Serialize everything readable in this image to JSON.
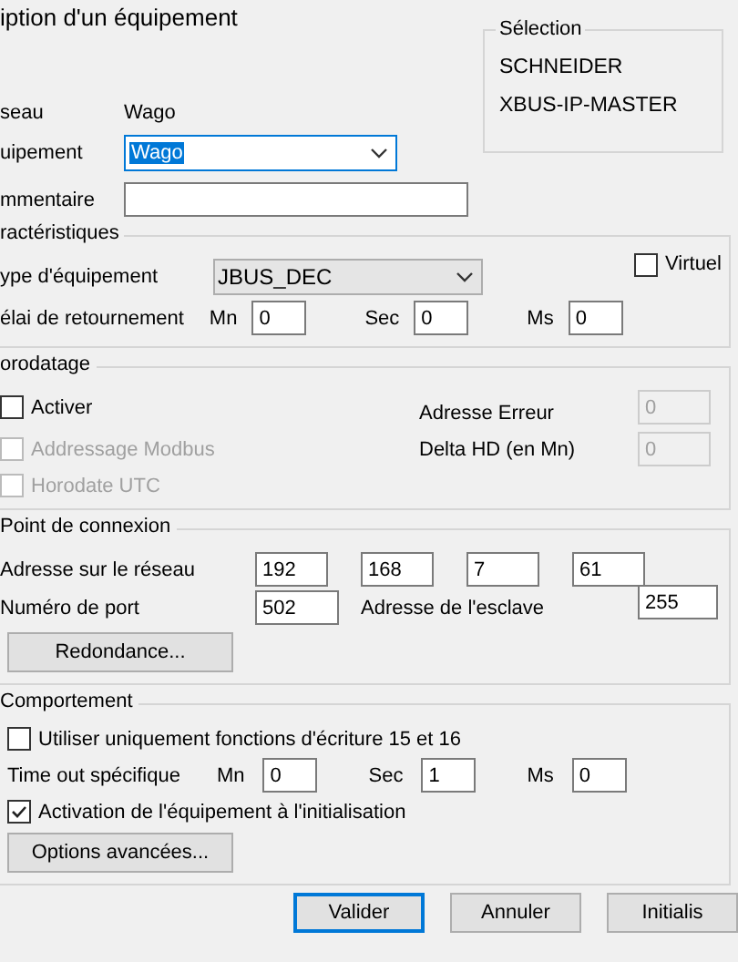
{
  "window": {
    "title": "iption d'un équipement"
  },
  "selection": {
    "title": "Sélection",
    "items": [
      "SCHNEIDER",
      "XBUS-IP-MASTER"
    ]
  },
  "identity": {
    "network_label": "seau",
    "network_value": "Wago",
    "equipment_label": "uipement",
    "equipment_value": "Wago",
    "equipment_text_selected": true,
    "comment_label": "mmentaire"
  },
  "characteristics": {
    "title": "ractéristiques",
    "virtual": {
      "label": "Virtuel",
      "checked": false
    },
    "type_label": "ype d'équipement",
    "type_value": "JBUS_DEC",
    "delay_label": "élai de retournement",
    "delay": [
      {
        "unit": "Mn",
        "value": "0"
      },
      {
        "unit": "Sec",
        "value": "0"
      },
      {
        "unit": "Ms",
        "value": "0"
      }
    ]
  },
  "timestamping": {
    "title": "orodatage",
    "options": [
      {
        "label": "Activer",
        "checked": false,
        "disabled": false
      },
      {
        "label": "Addressage Modbus",
        "checked": false,
        "disabled": true
      },
      {
        "label": "Horodate UTC",
        "checked": false,
        "disabled": true
      }
    ],
    "fields": [
      {
        "label": "Adresse Erreur",
        "value": "0",
        "disabled": true
      },
      {
        "label": "Delta HD (en Mn)",
        "value": "0",
        "disabled": true
      }
    ]
  },
  "connection": {
    "title": "Point de connexion",
    "address_label": "Adresse sur le réseau",
    "address": [
      "192",
      "168",
      "7",
      "61"
    ],
    "port_label": "Numéro de port",
    "port": "502",
    "slave_label": "Adresse de l'esclave",
    "slave": "255",
    "redundancy_button": "Redondance..."
  },
  "behavior": {
    "title": "Comportement",
    "write_only": {
      "label": "Utiliser uniquement fonctions d'écriture 15 et 16",
      "checked": false
    },
    "timeout_label": "Time out spécifique",
    "timeout": [
      {
        "unit": "Mn",
        "value": "0"
      },
      {
        "unit": "Sec",
        "value": "1"
      },
      {
        "unit": "Ms",
        "value": "0"
      }
    ],
    "init": {
      "label": "Activation de l'équipement à l'initialisation",
      "checked": true
    },
    "advanced_button": "Options avancées..."
  },
  "buttons": [
    {
      "label": "Valider",
      "default": true
    },
    {
      "label": "Annuler",
      "default": false
    },
    {
      "label": "Initialis",
      "default": false
    }
  ]
}
